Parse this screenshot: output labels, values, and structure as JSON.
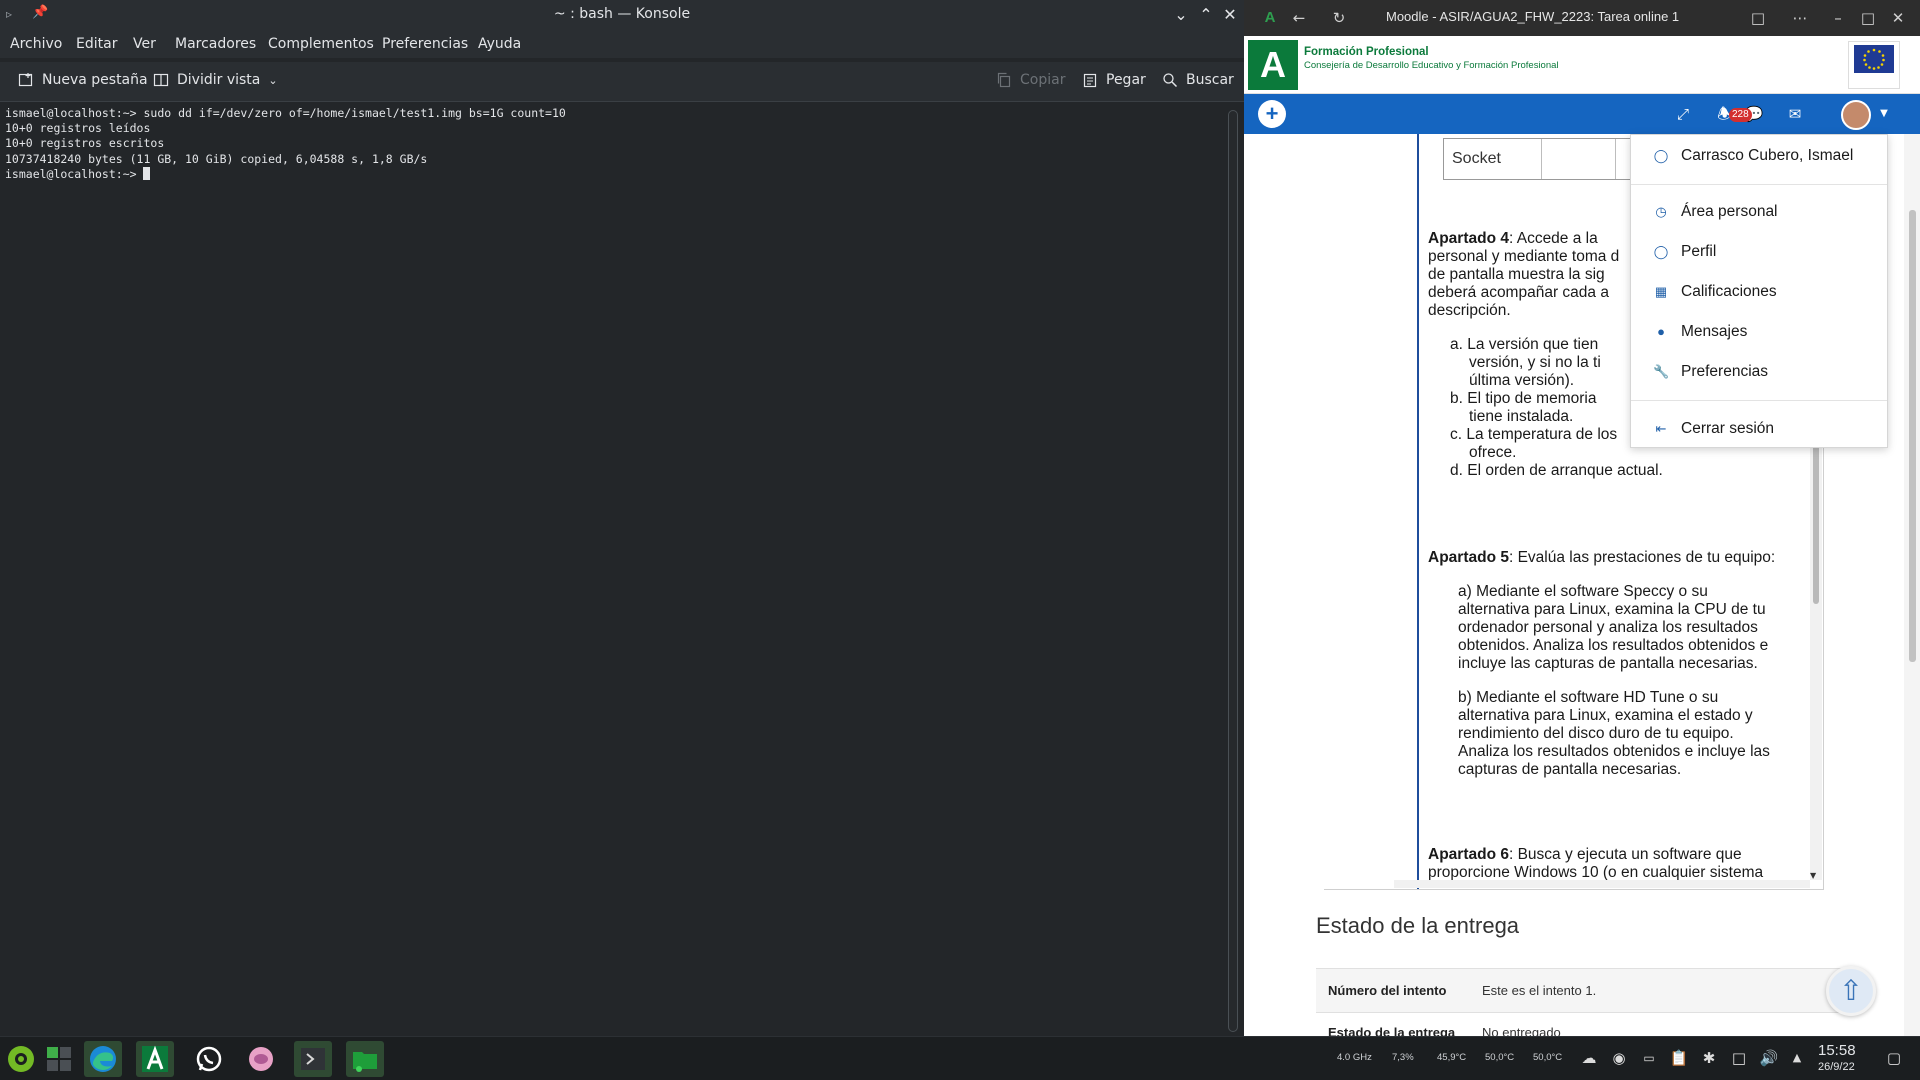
{
  "konsole": {
    "title": "~ : bash — Konsole",
    "menu": [
      "Archivo",
      "Editar",
      "Ver",
      "Marcadores",
      "Complementos",
      "Preferencias",
      "Ayuda"
    ],
    "toolbar": {
      "new_tab": "Nueva pestaña",
      "split_view": "Dividir vista",
      "copy": "Copiar",
      "paste": "Pegar",
      "find": "Buscar"
    },
    "terminal_lines": [
      "ismael@localhost:~> sudo dd if=/dev/zero of=/home/ismael/test1.img bs=1G count=10",
      "10+0 registros leídos",
      "10+0 registros escritos",
      "10737418240 bytes (11 GB, 10 GiB) copied, 6,04588 s, 1,8 GB/s",
      "ismael@localhost:~> "
    ]
  },
  "browser": {
    "title": "Moodle - ASIR/AGUA2_FHW_2223: Tarea online 1",
    "header": {
      "logo_letter": "A",
      "fp_title": "Formación Profesional",
      "fp_subtitle": "Consejería de Desarrollo Educativo y Formación Profesional"
    },
    "nav": {
      "notifications_count": "228"
    },
    "document": {
      "socket_cell": "Socket",
      "apartado4_label": "Apartado 4",
      "apartado4_text": ": Accede a la",
      "apartado4_line2": "personal y mediante toma d",
      "apartado4_line3": "de pantalla muestra la sig",
      "apartado4_line4": "deberá acompañar cada a",
      "apartado4_line5": "descripción.",
      "list_a1": "a. La versión que tien",
      "list_a2": "versión, y si no la ti",
      "list_a3": "última versión).",
      "list_b1": "b. El tipo de memoria",
      "list_b2": "tiene instalada.",
      "list_c1": "c. La temperatura de los",
      "list_c2": "ofrece.",
      "list_d": "d. El orden de arranque actual.",
      "apartado5_label": "Apartado 5",
      "apartado5_text": ": Evalúa las prestaciones de tu equipo:",
      "a5a_lines": [
        "a)  Mediante  el  software  Speccy  o  su",
        "alternativa para Linux, examina la CPU de tu",
        "ordenador personal y analiza los resultados",
        "obtenidos. Analiza los resultados obtenidos e",
        "incluye las capturas de pantalla necesarias."
      ],
      "a5b_lines": [
        "b)  Mediante  el  software  HD  Tune  o  su",
        "alternativa para Linux, examina el estado y",
        "rendimiento del disco duro de tu equipo.",
        "Analiza los resultados obtenidos e incluye las",
        "capturas de pantalla necesarias."
      ],
      "apartado6_label": "Apartado 6",
      "apartado6_text": ": Busca y ejecuta un software que",
      "apartado6_line2": "proporcione Windows 10 (o en cualquier sistema"
    },
    "user_menu": {
      "user_name": "Carrasco Cubero, Ismael",
      "items": [
        "Área personal",
        "Perfil",
        "Calificaciones",
        "Mensajes",
        "Preferencias"
      ],
      "logout": "Cerrar sesión"
    },
    "estado": {
      "title": "Estado de la entrega",
      "rows": [
        {
          "key": "Número del intento",
          "value": "Este es el intento 1."
        },
        {
          "key": "Estado de la entrega",
          "value": "No entregado"
        }
      ]
    }
  },
  "taskbar": {
    "tray": {
      "cpu_freq": "4.0 GHz",
      "cpu_load": "7,3%",
      "temp1": "45,9°C",
      "temp2": "50,0°C",
      "temp3": "50,0°C"
    },
    "clock": {
      "time": "15:58",
      "date": "26/9/22"
    }
  }
}
